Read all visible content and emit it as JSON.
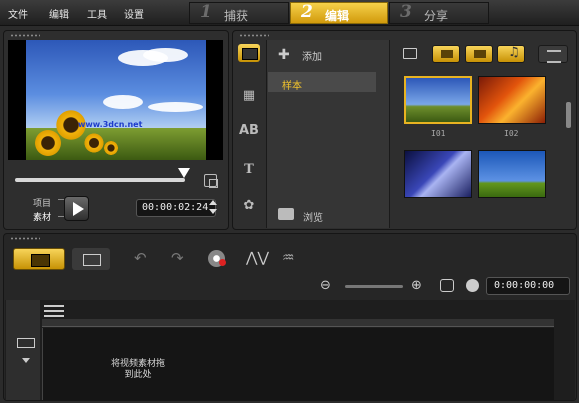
{
  "menu": [
    "文件",
    "编辑",
    "工具",
    "设置"
  ],
  "steps": [
    {
      "num": "1",
      "label": "捕获"
    },
    {
      "num": "2",
      "label": "编辑"
    },
    {
      "num": "3",
      "label": "分享"
    }
  ],
  "active_step": 1,
  "player": {
    "watermark": "www.3dcn.net",
    "mode_project": "项目",
    "mode_clip": "素材",
    "timecode": "00:00:02:24"
  },
  "library": {
    "add_label": "添加",
    "folder": "样本",
    "browse_label": "浏览",
    "thumbnails": [
      "I01",
      "I02",
      "",
      ""
    ]
  },
  "timeline": {
    "duration": "0:00:00:00",
    "drop_hint": "将视频素材拖到此处"
  },
  "colors": {
    "accent": "#f2c42c",
    "background": "#2b2b2b"
  }
}
